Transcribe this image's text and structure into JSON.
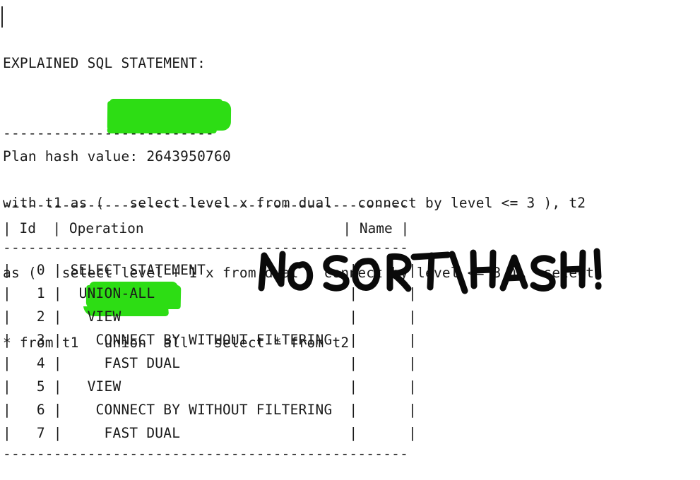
{
  "document": {
    "title": "EXPLAINED SQL STATEMENT:",
    "title_underline": "-------------------------",
    "sql_lines": [
      "with t1 as (   select level x from dual   connect by level <= 3 ), t2",
      "as (   select level + 1 x from dual   connect by level <= 3 )   select",
      "* from t1   union  all   select * from t2"
    ],
    "plan_hash_label": "Plan hash value:",
    "plan_hash_value": "2643950760",
    "plan_hash_line": "Plan hash value: 2643950760"
  },
  "plan_table": {
    "top_rule": "------------------------------------------------",
    "header_line": "| Id  | Operation                        | Name |",
    "header_rule": "------------------------------------------------",
    "bottom_rule": "------------------------------------------------",
    "columns": [
      "Id",
      "Operation",
      "Name"
    ],
    "rows": [
      {
        "line": "|   0 | SELECT STATEMENT                 |      |",
        "id": "0",
        "operation": "SELECT STATEMENT",
        "name": "",
        "indent": 0
      },
      {
        "line": "|   1 |  UNION-ALL                       |      |",
        "id": "1",
        "operation": "UNION-ALL",
        "name": "",
        "indent": 1
      },
      {
        "line": "|   2 |   VIEW                           |      |",
        "id": "2",
        "operation": "VIEW",
        "name": "",
        "indent": 2
      },
      {
        "line": "|   3 |    CONNECT BY WITHOUT FILTERING  |      |",
        "id": "3",
        "operation": "CONNECT BY WITHOUT FILTERING",
        "name": "",
        "indent": 3
      },
      {
        "line": "|   4 |     FAST DUAL                    |      |",
        "id": "4",
        "operation": "FAST DUAL",
        "name": "",
        "indent": 4
      },
      {
        "line": "|   5 |   VIEW                           |      |",
        "id": "5",
        "operation": "VIEW",
        "name": "",
        "indent": 2
      },
      {
        "line": "|   6 |    CONNECT BY WITHOUT FILTERING  |      |",
        "id": "6",
        "operation": "CONNECT BY WITHOUT FILTERING",
        "name": "",
        "indent": 3
      },
      {
        "line": "|   7 |     FAST DUAL                    |      |",
        "id": "7",
        "operation": "FAST DUAL",
        "name": "",
        "indent": 4
      }
    ]
  },
  "annotations": {
    "handwritten_note": "NO SORT/HASH!",
    "highlight_color": "#2ddd14",
    "highlighted_sql_text": "union  all",
    "highlighted_operation_text": "UNION-ALL"
  },
  "rendered_lines": {
    "l0": "EXPLAINED SQL STATEMENT:",
    "l1": "-------------------------",
    "l2": "with t1 as (   select level x from dual   connect by level <= 3 ), t2",
    "l3": "as (   select level + 1 x from dual   connect by level <= 3 )   select",
    "l4": "* from t1   union  all   select * from t2",
    "l5": "Plan hash value: 2643950760",
    "rule_top": "------------------------------------------------",
    "hdr": "| Id  | Operation                        | Name |",
    "rule_mid": "------------------------------------------------",
    "r0": "|   0 | SELECT STATEMENT                 |      |",
    "r1": "|   1 |  UNION-ALL                       |      |",
    "r2": "|   2 |   VIEW                           |      |",
    "r3": "|   3 |    CONNECT BY WITHOUT FILTERING  |      |",
    "r4": "|   4 |     FAST DUAL                    |      |",
    "r5": "|   5 |   VIEW                           |      |",
    "r6": "|   6 |    CONNECT BY WITHOUT FILTERING  |      |",
    "r7": "|   7 |     FAST DUAL                    |      |",
    "rule_bot": "------------------------------------------------"
  }
}
